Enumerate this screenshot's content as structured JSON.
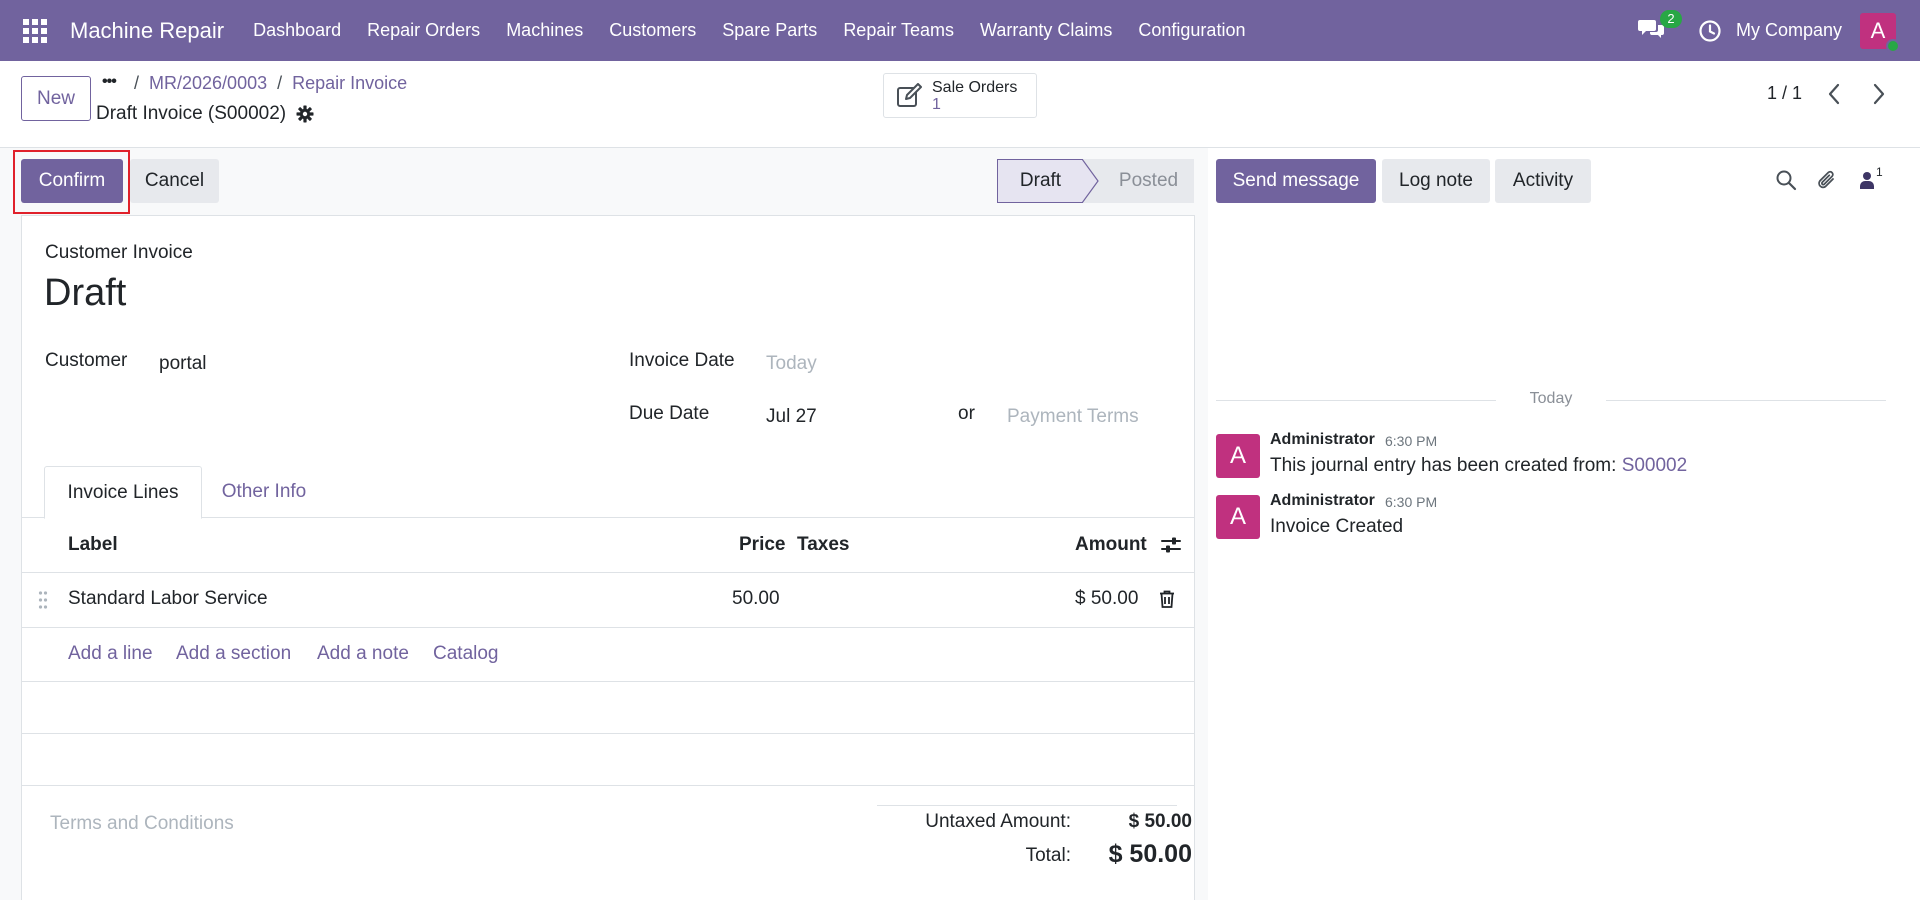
{
  "colors": {
    "brand": "#71639e",
    "avatar": "#c0317f",
    "online": "#28a745",
    "highlight": "#e0212b"
  },
  "navbar": {
    "app_name": "Machine Repair",
    "menu": [
      "Dashboard",
      "Repair Orders",
      "Machines",
      "Customers",
      "Spare Parts",
      "Repair Teams",
      "Warranty Claims",
      "Configuration"
    ],
    "chat_count": "2",
    "company": "My Company",
    "user_initial": "A"
  },
  "control_panel": {
    "new_label": "New",
    "more_label": "•••",
    "breadcrumb": [
      "MR/2026/0003",
      "Repair Invoice"
    ],
    "breadcrumb_sep": "/",
    "record_title": "Draft Invoice (S00002)",
    "smart_button": {
      "label": "Sale Orders",
      "value": "1"
    },
    "pager": "1 / 1"
  },
  "statusbar": {
    "confirm_label": "Confirm",
    "cancel_label": "Cancel",
    "stages": [
      "Draft",
      "Posted"
    ]
  },
  "form": {
    "doc_type": "Customer Invoice",
    "state": "Draft",
    "customer_label": "Customer",
    "customer_value": "portal",
    "invoice_date_label": "Invoice Date",
    "invoice_date_placeholder": "Today",
    "due_date_label": "Due Date",
    "due_date_value": "Jul 27",
    "or_label": "or",
    "payment_terms_placeholder": "Payment Terms",
    "tabs": [
      "Invoice Lines",
      "Other Info"
    ],
    "columns": {
      "label": "Label",
      "price": "Price",
      "taxes": "Taxes",
      "amount": "Amount"
    },
    "lines": [
      {
        "label": "Standard Labor Service",
        "price": "50.00",
        "taxes": "",
        "amount": "$ 50.00"
      }
    ],
    "add_links": [
      "Add a line",
      "Add a section",
      "Add a note",
      "Catalog"
    ],
    "terms_placeholder": "Terms and Conditions",
    "untaxed_label": "Untaxed Amount:",
    "untaxed_value": "$ 50.00",
    "total_label": "Total:",
    "total_value": "$ 50.00"
  },
  "chatter": {
    "send_message_label": "Send message",
    "log_note_label": "Log note",
    "activity_label": "Activity",
    "follower_count": "1",
    "date_separator": "Today",
    "messages": [
      {
        "avatar": "A",
        "author": "Administrator",
        "time": "6:30 PM",
        "body": "This journal entry has been created from: ",
        "link": "S00002"
      },
      {
        "avatar": "A",
        "author": "Administrator",
        "time": "6:30 PM",
        "body": "Invoice Created"
      }
    ]
  },
  "icons": [
    "apps-grid-icon",
    "chat-icon",
    "clock-icon",
    "gear-icon",
    "edit-icon",
    "chevron-left-icon",
    "chevron-right-icon",
    "drag-handle-icon",
    "trash-icon",
    "column-settings-icon",
    "search-icon",
    "paperclip-icon",
    "followers-icon"
  ]
}
